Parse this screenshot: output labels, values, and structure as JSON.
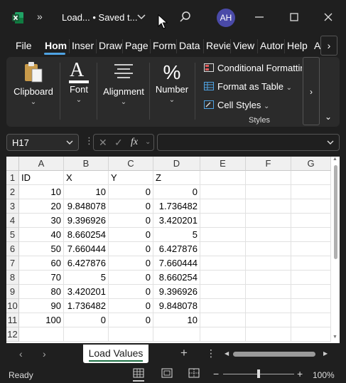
{
  "titlebar": {
    "more_glyph": "»",
    "doc_title": "Load...  • Saved t...",
    "avatar_initials": "AH",
    "brand_color": "#1e7145",
    "avatar_color": "#4a4aa8"
  },
  "menu": {
    "tabs": [
      "File",
      "Hom",
      "Inser",
      "Draw",
      "Page",
      "Form",
      "Data",
      "Revie",
      "View",
      "Autor",
      "Help",
      "A"
    ],
    "active_tab": "Hom",
    "more_glyph": "›",
    "accent_color": "#4fa3e3"
  },
  "ribbon": {
    "clipboard": "Clipboard",
    "font": "Font",
    "alignment": "Alignment",
    "number": "Number",
    "number_glyph": "%",
    "font_glyph": "A",
    "conditional_formatting": "Conditional Formatting",
    "format_as_table": "Format as Table",
    "cell_styles": "Cell Styles",
    "styles_group": "Styles",
    "dropdown_glyph": "⌄",
    "right_glyph": "›",
    "collapse_glyph": "⌄"
  },
  "formula_bar": {
    "name_box": "H17",
    "formula": "",
    "fx_label": "fx"
  },
  "sheet": {
    "columns": [
      "A",
      "B",
      "C",
      "D",
      "E",
      "F",
      "G"
    ],
    "row_numbers": [
      "1",
      "2",
      "3",
      "4",
      "5",
      "6",
      "7",
      "8",
      "9",
      "10",
      "11",
      "12"
    ],
    "rows": [
      [
        "ID",
        "X",
        "Y",
        "Z",
        "",
        "",
        ""
      ],
      [
        "10",
        "10",
        "0",
        "0",
        "",
        "",
        ""
      ],
      [
        "20",
        "9.848078",
        "0",
        "1.736482",
        "",
        "",
        ""
      ],
      [
        "30",
        "9.396926",
        "0",
        "3.420201",
        "",
        "",
        ""
      ],
      [
        "40",
        "8.660254",
        "0",
        "5",
        "",
        "",
        ""
      ],
      [
        "50",
        "7.660444",
        "0",
        "6.427876",
        "",
        "",
        ""
      ],
      [
        "60",
        "6.427876",
        "0",
        "7.660444",
        "",
        "",
        ""
      ],
      [
        "70",
        "5",
        "0",
        "8.660254",
        "",
        "",
        ""
      ],
      [
        "80",
        "3.420201",
        "0",
        "9.396926",
        "",
        "",
        ""
      ],
      [
        "90",
        "1.736482",
        "0",
        "9.848078",
        "",
        "",
        ""
      ],
      [
        "100",
        "0",
        "0",
        "10",
        "",
        "",
        ""
      ],
      [
        "",
        "",
        "",
        "",
        "",
        "",
        ""
      ]
    ],
    "tab_name": "Load Values",
    "add_glyph": "+",
    "menu_glyph": "⋮"
  },
  "status": {
    "text": "Ready",
    "zoom_minus": "−",
    "zoom_plus": "+",
    "zoom": "100%"
  }
}
